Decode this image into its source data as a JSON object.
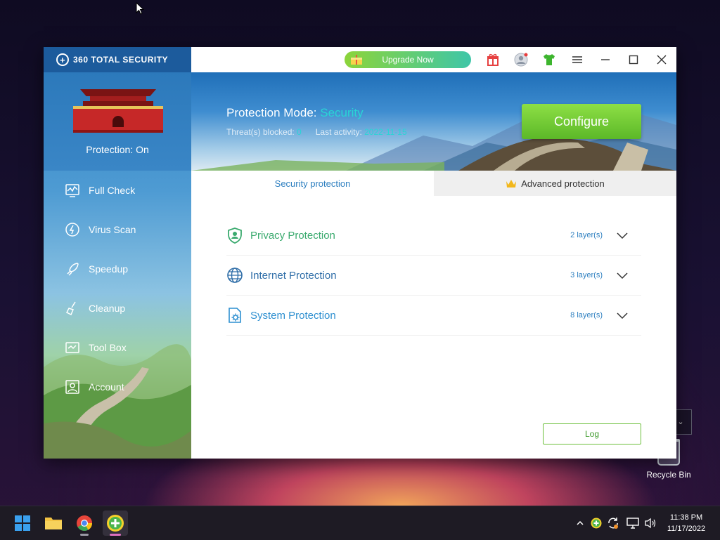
{
  "app": {
    "brand": "360 TOTAL SECURITY",
    "protection_status": "Protection: On",
    "nav": [
      {
        "label": "Full Check",
        "icon": "full-check-icon"
      },
      {
        "label": "Virus Scan",
        "icon": "virus-scan-icon"
      },
      {
        "label": "Speedup",
        "icon": "rocket-icon"
      },
      {
        "label": "Cleanup",
        "icon": "broom-icon"
      },
      {
        "label": "Tool Box",
        "icon": "toolbox-icon"
      },
      {
        "label": "Account",
        "icon": "account-icon"
      }
    ],
    "titlebar": {
      "upgrade_label": "Upgrade Now"
    },
    "hero": {
      "mode_label": "Protection Mode:",
      "mode_value": "Security",
      "threats_label": "Threat(s) blocked:",
      "threats_value": "0",
      "activity_label": "Last activity:",
      "activity_value": "2022-11-15",
      "configure_label": "Configure"
    },
    "tabs": [
      {
        "label": "Security protection",
        "active": true
      },
      {
        "label": "Advanced protection",
        "active": false
      }
    ],
    "protections": [
      {
        "name": "Privacy Protection",
        "layers": "2 layer(s)",
        "color": "#3aaa6e"
      },
      {
        "name": "Internet Protection",
        "layers": "3 layer(s)",
        "color": "#2f6ea8"
      },
      {
        "name": "System Protection",
        "layers": "8 layer(s)",
        "color": "#2d8fd0"
      }
    ],
    "log_label": "Log"
  },
  "desktop": {
    "recycle_bin_label": "Recycle Bin"
  },
  "taskbar": {
    "time": "11:38 PM",
    "date": "11/17/2022"
  },
  "colors": {
    "accent_green": "#6cbf3a",
    "accent_blue": "#2d7fc0",
    "status_cyan": "#29d5d5"
  }
}
